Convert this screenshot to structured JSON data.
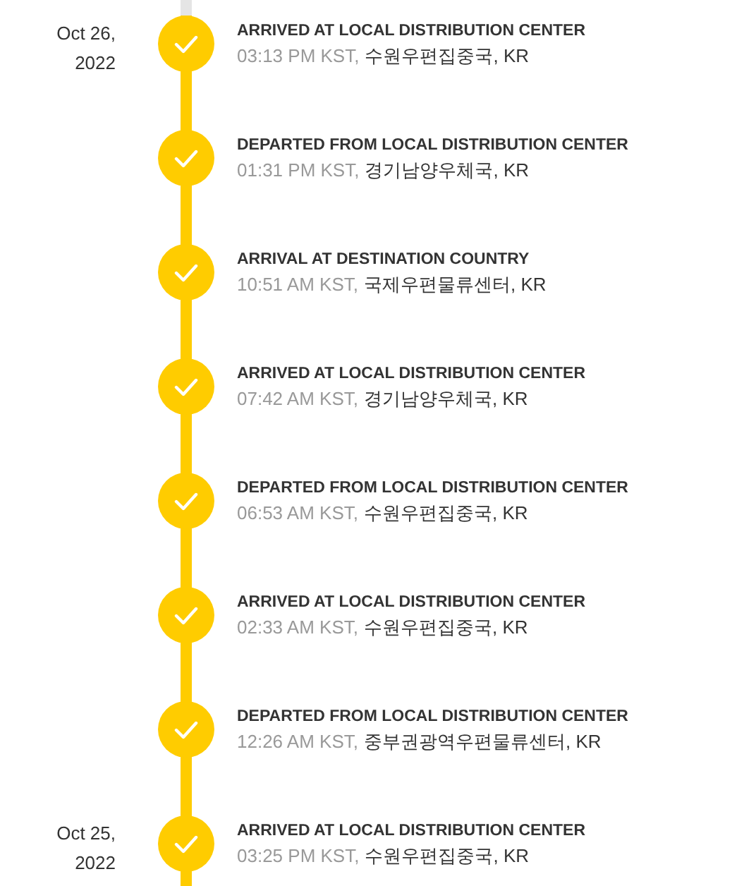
{
  "events": [
    {
      "date": "Oct 26, 2022",
      "status": "ARRIVED AT LOCAL DISTRIBUTION CENTER",
      "time": "03:13 PM KST,",
      "location": "수원우편집중국, KR",
      "done": true
    },
    {
      "status": "DEPARTED FROM LOCAL DISTRIBUTION CENTER",
      "time": "01:31 PM KST,",
      "location": "경기남양우체국, KR",
      "done": true
    },
    {
      "status": "ARRIVAL AT DESTINATION COUNTRY",
      "time": "10:51 AM KST,",
      "location": "국제우편물류센터, KR",
      "done": true
    },
    {
      "status": "ARRIVED AT LOCAL DISTRIBUTION CENTER",
      "time": "07:42 AM KST,",
      "location": "경기남양우체국, KR",
      "done": true
    },
    {
      "status": "DEPARTED FROM LOCAL DISTRIBUTION CENTER",
      "time": "06:53 AM KST,",
      "location": "수원우편집중국, KR",
      "done": true
    },
    {
      "status": "ARRIVED AT LOCAL DISTRIBUTION CENTER",
      "time": "02:33 AM KST,",
      "location": "수원우편집중국, KR",
      "done": true
    },
    {
      "status": "DEPARTED FROM LOCAL DISTRIBUTION CENTER",
      "time": "12:26 AM KST,",
      "location": "중부권광역우편물류센터, KR",
      "done": true
    },
    {
      "date": "Oct 25, 2022",
      "status": "ARRIVED AT LOCAL DISTRIBUTION CENTER",
      "time": "03:25 PM KST,",
      "location": "수원우편집중국, KR",
      "done": true
    }
  ]
}
